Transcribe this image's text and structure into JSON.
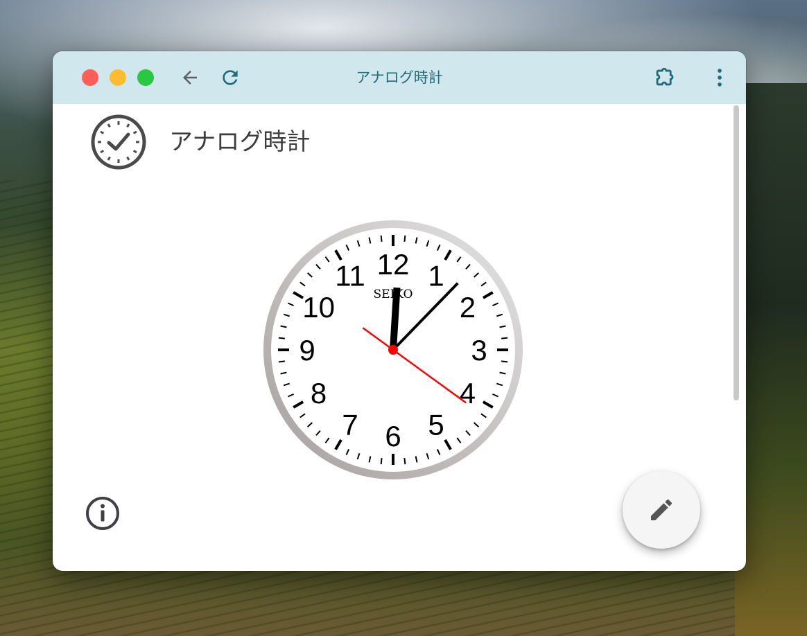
{
  "window": {
    "title": "アナログ時計"
  },
  "titlebar": {
    "traffic_lights": {
      "close": "#fe5f57",
      "minimize": "#febc2e",
      "maximize": "#28c840"
    },
    "back_icon": "arrow-left-icon",
    "reload_icon": "reload-icon",
    "extension_icon": "puzzle-icon",
    "menu_icon": "more-vert-icon",
    "accent_color": "#1f6b78"
  },
  "app": {
    "title": "アナログ時計",
    "icon": "clock-icon"
  },
  "clock": {
    "brand": "SEIKO",
    "numbers": [
      "12",
      "1",
      "2",
      "3",
      "4",
      "5",
      "6",
      "7",
      "8",
      "9",
      "10",
      "11"
    ],
    "time": {
      "hour": 12,
      "minute": 7,
      "second": 21
    },
    "hand_colors": {
      "hour": "#000000",
      "minute": "#000000",
      "second": "#ff0000"
    }
  },
  "footer": {
    "info_icon": "info-icon",
    "edit_icon": "pencil-icon"
  }
}
